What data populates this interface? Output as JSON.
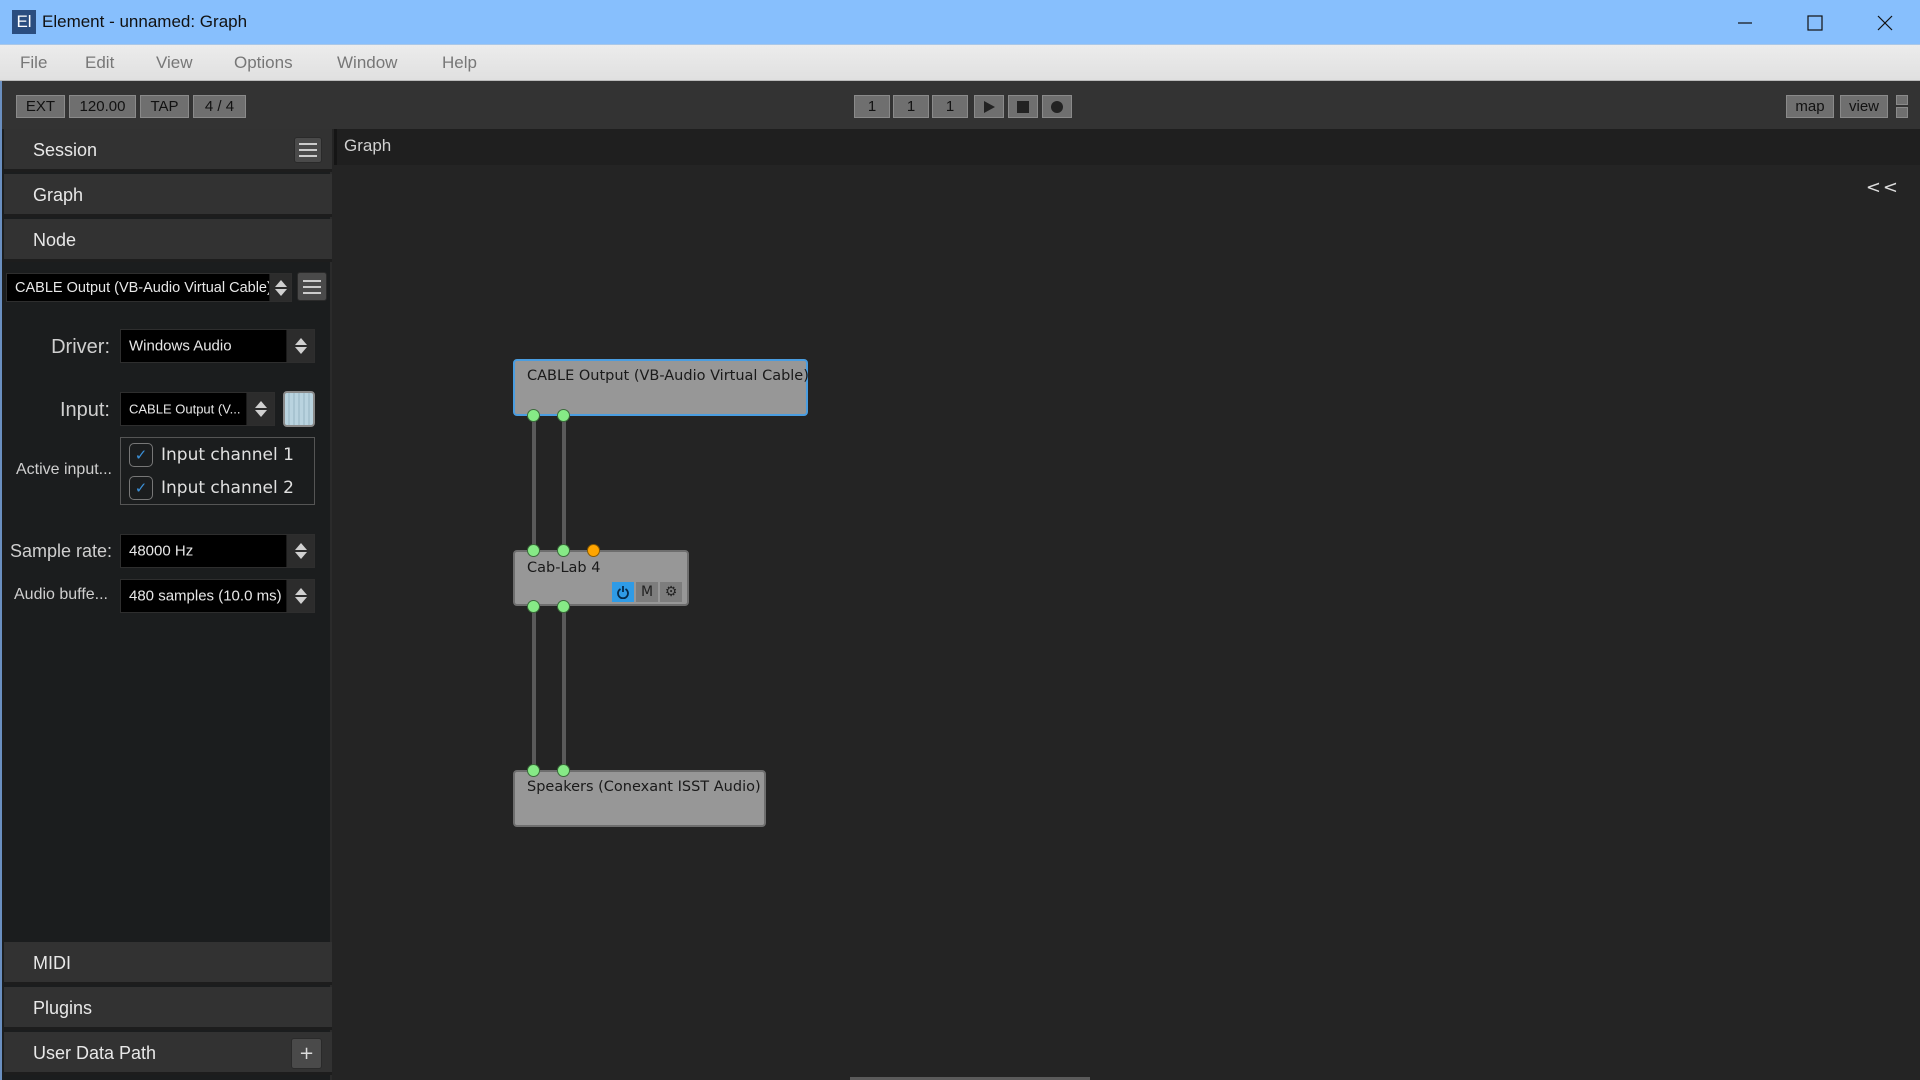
{
  "window": {
    "app_icon": "El",
    "title": "Element - unnamed: Graph",
    "controls": [
      "minimize",
      "maximize",
      "close"
    ]
  },
  "menu": [
    "File",
    "Edit",
    "View",
    "Options",
    "Window",
    "Help"
  ],
  "toolbar": {
    "sync": "EXT",
    "tempo": "120.00",
    "tap": "TAP",
    "meter": "4 / 4",
    "position": [
      "1",
      "1",
      "1"
    ],
    "transport": [
      "play-icon",
      "stop-icon",
      "record-icon"
    ],
    "map": "map",
    "view": "view"
  },
  "sidebar": {
    "panels_top": [
      {
        "label": "Session",
        "has_menu": true
      },
      {
        "label": "Graph"
      },
      {
        "label": "Node"
      }
    ],
    "node_selector": "CABLE Output (VB-Audio Virtual Cable)",
    "device": {
      "driver_label": "Driver:",
      "driver_value": "Windows Audio",
      "input_label": "Input:",
      "input_value": "CABLE Output (V...",
      "active_inputs_label": "Active input...",
      "channels": [
        {
          "label": "Input channel 1",
          "checked": true
        },
        {
          "label": "Input channel 2",
          "checked": true
        }
      ],
      "sample_rate_label": "Sample rate:",
      "sample_rate_value": "48000 Hz",
      "buffer_label": "Audio buffe...",
      "buffer_value": "480 samples (10.0 ms)"
    },
    "panels_bottom": [
      {
        "label": "MIDI"
      },
      {
        "label": "Plugins"
      },
      {
        "label": "User Data Path",
        "action": "+"
      }
    ]
  },
  "graph": {
    "title": "Graph",
    "collapse": "<<",
    "nodes": [
      {
        "name": "CABLE Output (VB-Audio Virtual Cable)",
        "selected": true,
        "inputs": 0,
        "outputs": 2
      },
      {
        "name": "Cab-Lab 4",
        "selected": false,
        "inputs": 2,
        "midi_inputs": 1,
        "outputs": 2,
        "buttons": [
          "power",
          "M",
          "settings"
        ],
        "power_on": true
      },
      {
        "name": "Speakers (Conexant ISST Audio)",
        "selected": false,
        "inputs": 2,
        "outputs": 0
      }
    ]
  },
  "colors": {
    "titlebar": "#87bffd",
    "audio_port": "#86ea86",
    "midi_port": "#ffa500",
    "selection": "#4a9de0",
    "node_fill": "#979797"
  }
}
